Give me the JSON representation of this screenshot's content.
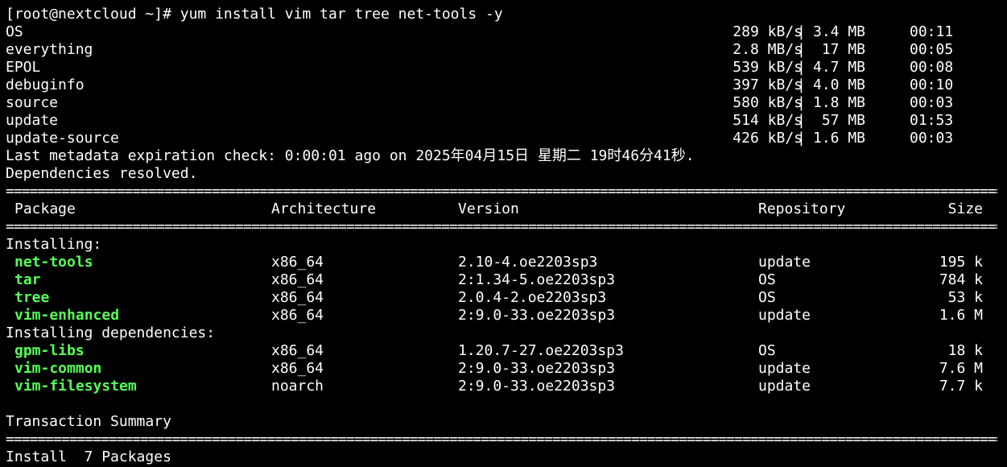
{
  "terminal": {
    "command_line": "[root@nextcloud ~]# yum install vim tar tree net-tools -y",
    "repos": [
      {
        "name": "OS",
        "speed": "289 kB/s",
        "size": "3.4 MB",
        "time": "00:11"
      },
      {
        "name": "everything",
        "speed": "2.8 MB/s",
        "size": " 17 MB",
        "time": "00:05"
      },
      {
        "name": "EPOL",
        "speed": "539 kB/s",
        "size": "4.7 MB",
        "time": "00:08"
      },
      {
        "name": "debuginfo",
        "speed": "397 kB/s",
        "size": "4.0 MB",
        "time": "00:10"
      },
      {
        "name": "source",
        "speed": "580 kB/s",
        "size": "1.8 MB",
        "time": "00:03"
      },
      {
        "name": "update",
        "speed": "514 kB/s",
        "size": " 57 MB",
        "time": "01:53"
      },
      {
        "name": "update-source",
        "speed": "426 kB/s",
        "size": "1.6 MB",
        "time": "00:03"
      }
    ],
    "metadata_check": "Last metadata expiration check: 0:00:01 ago on 2025年04月15日 星期二 19时46分41秒.",
    "deps_resolved": "Dependencies resolved.",
    "separator": "================================================================================================================================================",
    "table_headers": {
      "package": "Package",
      "arch": "Architecture",
      "version": "Version",
      "repo": "Repository",
      "size": "Size"
    },
    "installing_label": "Installing:",
    "installing": [
      {
        "name": "net-tools",
        "arch": "x86_64",
        "version": "2.10-4.oe2203sp3",
        "repo": "update",
        "size": "195 k"
      },
      {
        "name": "tar",
        "arch": "x86_64",
        "version": "2:1.34-5.oe2203sp3",
        "repo": "OS",
        "size": "784 k"
      },
      {
        "name": "tree",
        "arch": "x86_64",
        "version": "2.0.4-2.oe2203sp3",
        "repo": "OS",
        "size": "53 k"
      },
      {
        "name": "vim-enhanced",
        "arch": "x86_64",
        "version": "2:9.0-33.oe2203sp3",
        "repo": "update",
        "size": "1.6 M"
      }
    ],
    "deps_label": "Installing dependencies:",
    "dependencies": [
      {
        "name": "gpm-libs",
        "arch": "x86_64",
        "version": "1.20.7-27.oe2203sp3",
        "repo": "OS",
        "size": "18 k"
      },
      {
        "name": "vim-common",
        "arch": "x86_64",
        "version": "2:9.0-33.oe2203sp3",
        "repo": "update",
        "size": "7.6 M"
      },
      {
        "name": "vim-filesystem",
        "arch": "noarch",
        "version": "2:9.0-33.oe2203sp3",
        "repo": "update",
        "size": "7.7 k"
      }
    ],
    "transaction_summary": "Transaction Summary",
    "install_summary": "Install  7 Packages"
  },
  "colors": {
    "background": "#000000",
    "text": "#ffffff",
    "package_name": "#55ff55"
  }
}
